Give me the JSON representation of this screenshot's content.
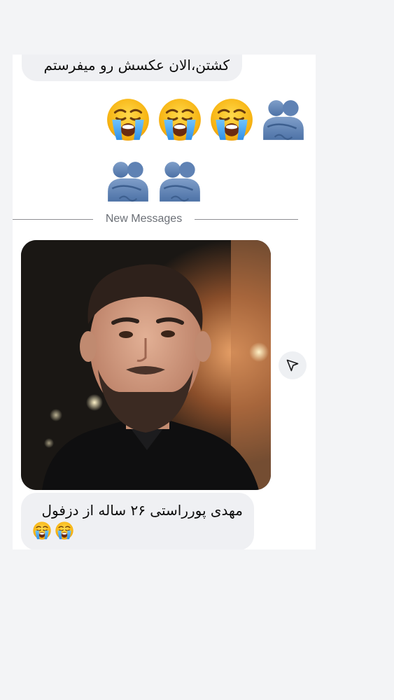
{
  "messages": {
    "top_text": "کشتن،الان عکسش رو میفرستم",
    "divider_label": "New Messages",
    "bottom_text": "مهدی پورراستی ۲۶ ساله از دزفول"
  },
  "emoji_rows": [
    [
      "people-hugging-icon",
      "loudly-crying-face-icon",
      "loudly-crying-face-icon",
      "loudly-crying-face-icon"
    ],
    [
      "people-hugging-icon",
      "people-hugging-icon"
    ]
  ],
  "bottom_emojis": [
    "loudly-crying-face-icon",
    "loudly-crying-face-icon"
  ],
  "icons": {
    "share": "send-icon",
    "photo": "portrait-photo"
  },
  "colors": {
    "bubble": "#eff0f3",
    "panel": "#ffffff",
    "background": "#f3f4f6",
    "divider_text": "#6b6f76"
  }
}
